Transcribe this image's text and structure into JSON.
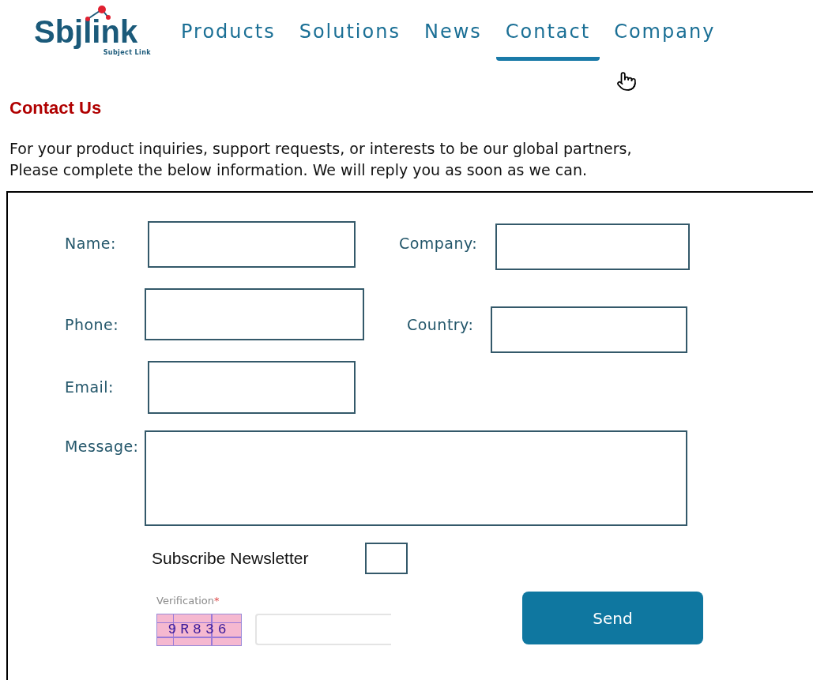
{
  "logo": {
    "name": "Sbjlink",
    "tagline": "Subject Link"
  },
  "nav": [
    {
      "label": "Products",
      "selected": false
    },
    {
      "label": "Solutions",
      "selected": false
    },
    {
      "label": "News",
      "selected": false
    },
    {
      "label": "Contact",
      "selected": true
    },
    {
      "label": "Company",
      "selected": false
    }
  ],
  "heading": "Contact Us",
  "intro": [
    "For your product inquiries, support requests, or interests to be our global partners,",
    "Please complete the below information. We will reply you as soon as we can."
  ],
  "form": {
    "fields": [
      {
        "label": "Name:"
      },
      {
        "label": "Company:"
      },
      {
        "label": "Phone:"
      },
      {
        "label": "Country:"
      },
      {
        "label": "Email:"
      }
    ],
    "message": {
      "label": "Message:"
    },
    "subscribe": {
      "label": "Subscribe Newsletter",
      "checked": false
    },
    "verification": {
      "label": "Verification",
      "required_mark": "*",
      "captcha": "9R836"
    },
    "submit": "Send"
  }
}
